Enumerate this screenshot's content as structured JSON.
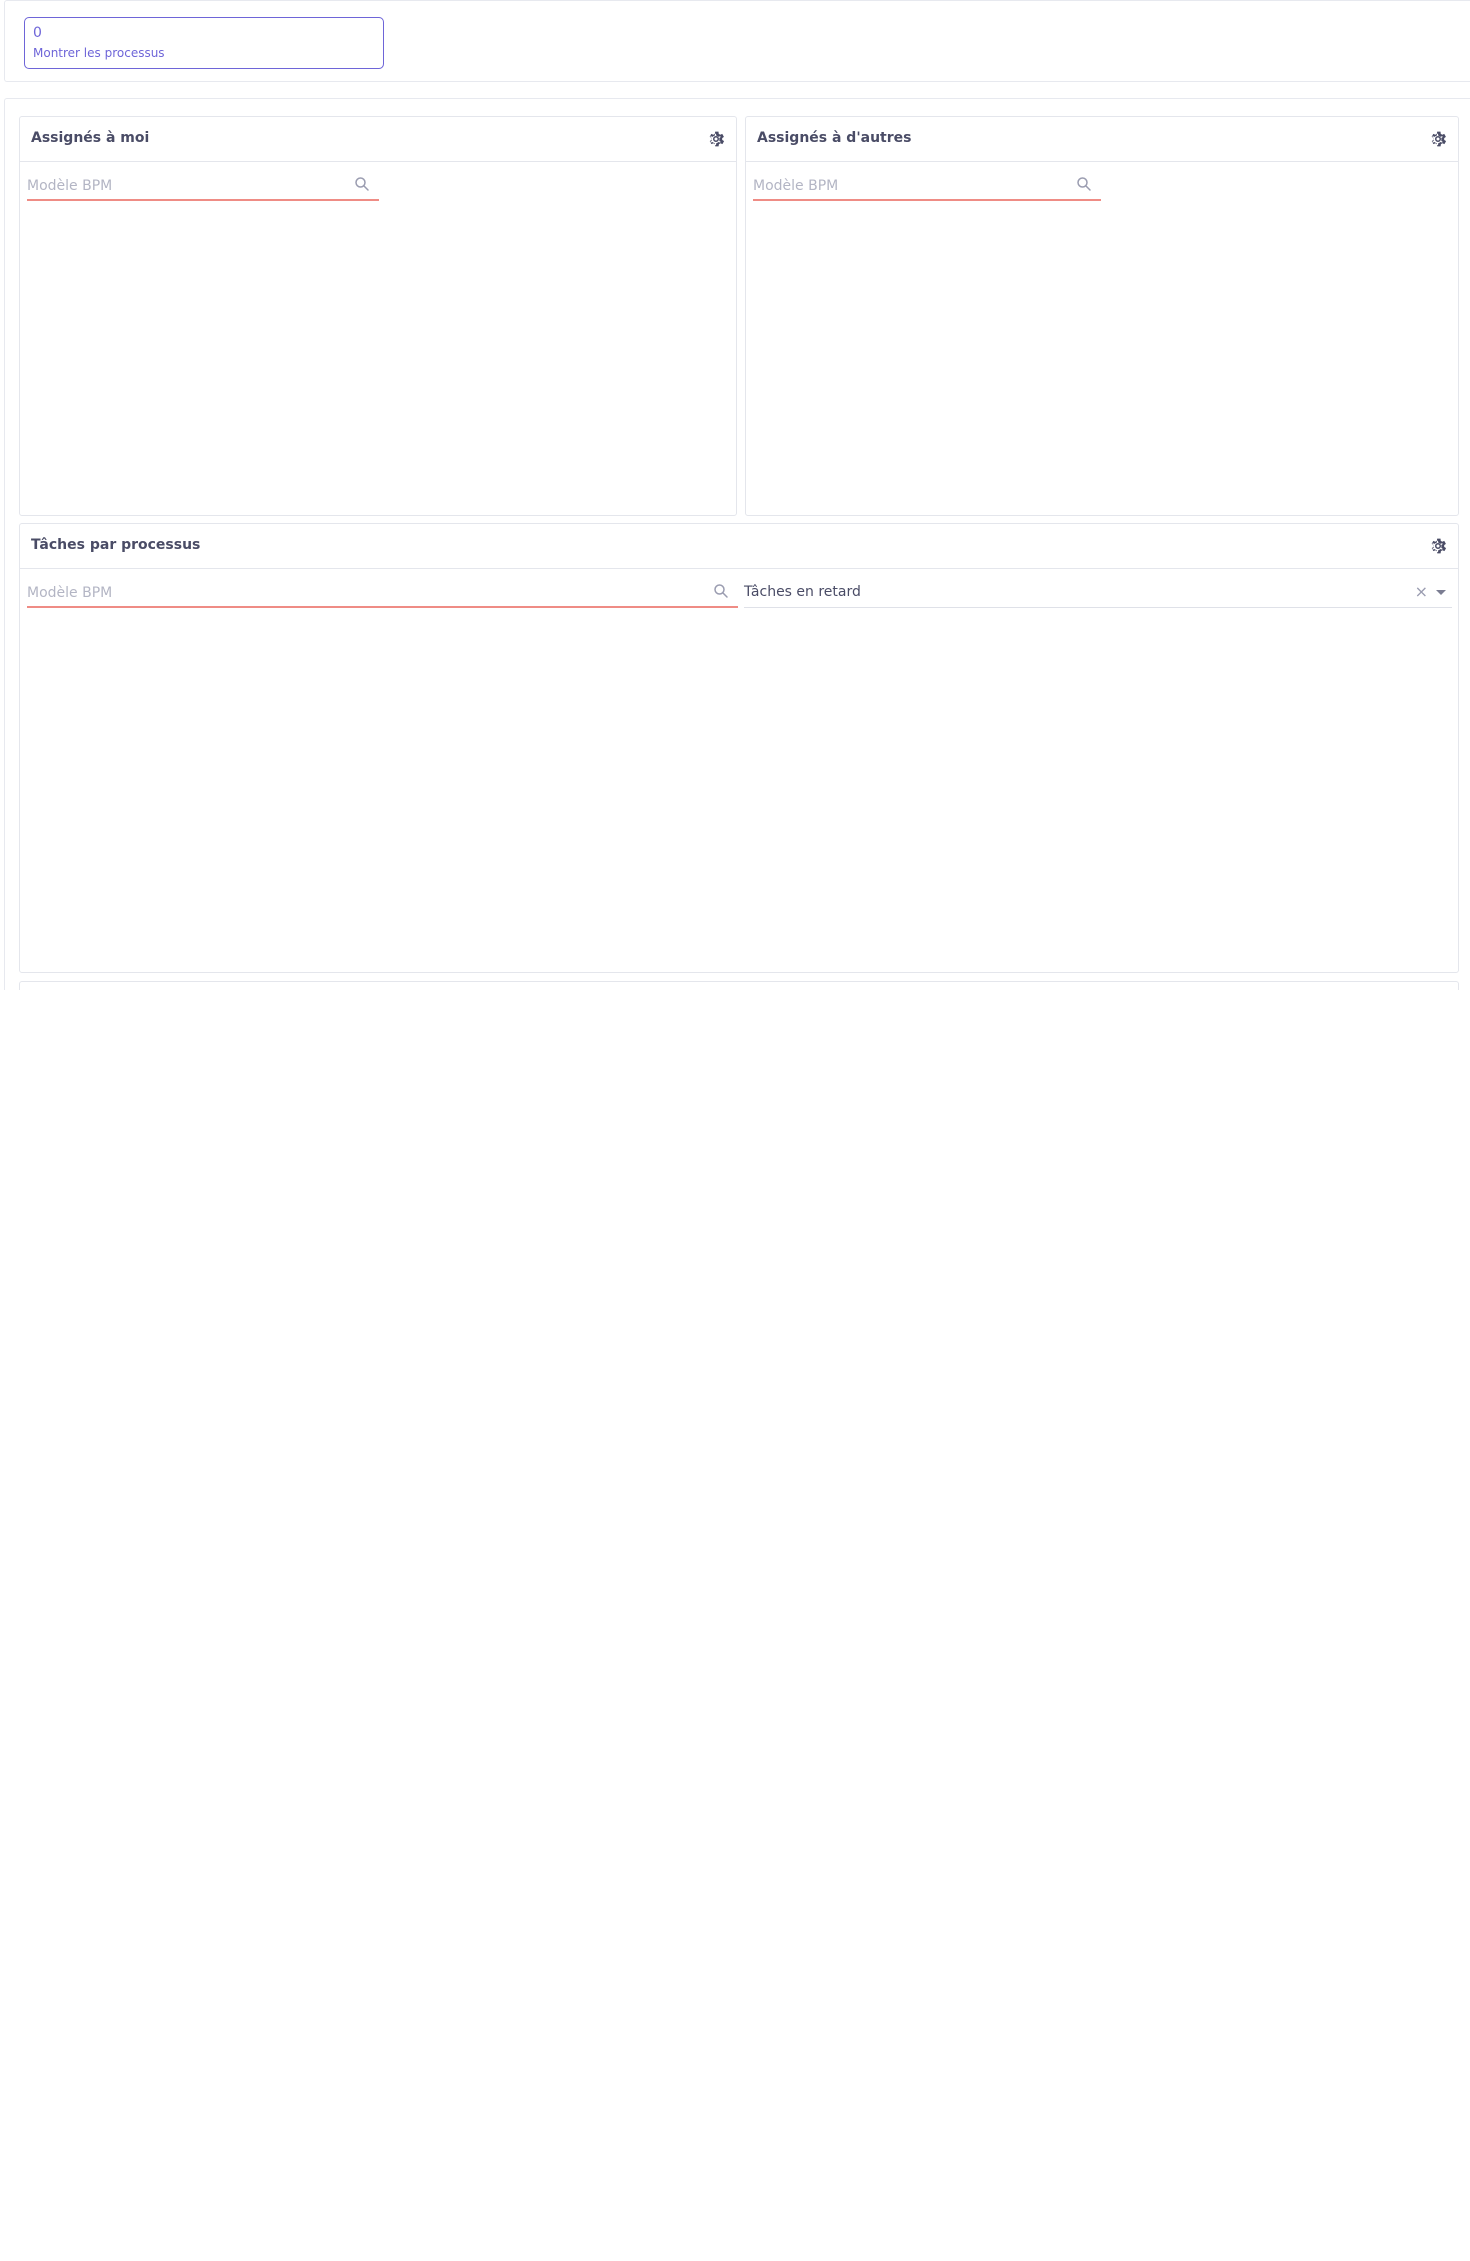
{
  "summary": {
    "count": "0",
    "label": "Montrer les processus"
  },
  "widgets": {
    "assigned_to_me": {
      "title": "Assignés à moi",
      "search_placeholder": "Modèle BPM"
    },
    "assigned_to_others": {
      "title": "Assignés à d'autres",
      "search_placeholder": "Modèle BPM"
    },
    "tasks_by_process": {
      "title": "Tâches par processus",
      "search_placeholder": "Modèle BPM",
      "filter_value": "Tâches en retard"
    }
  },
  "icons": {
    "settings": "gear-icon",
    "search": "search-icon",
    "clear": "close-icon",
    "dropdown": "chevron-down-icon"
  },
  "colors": {
    "accent": "#6e65d8",
    "input_underline": "#ef8c85",
    "border": "#e4e6ec",
    "title_text": "#4a4c66",
    "placeholder_text": "#b3b5c4"
  }
}
